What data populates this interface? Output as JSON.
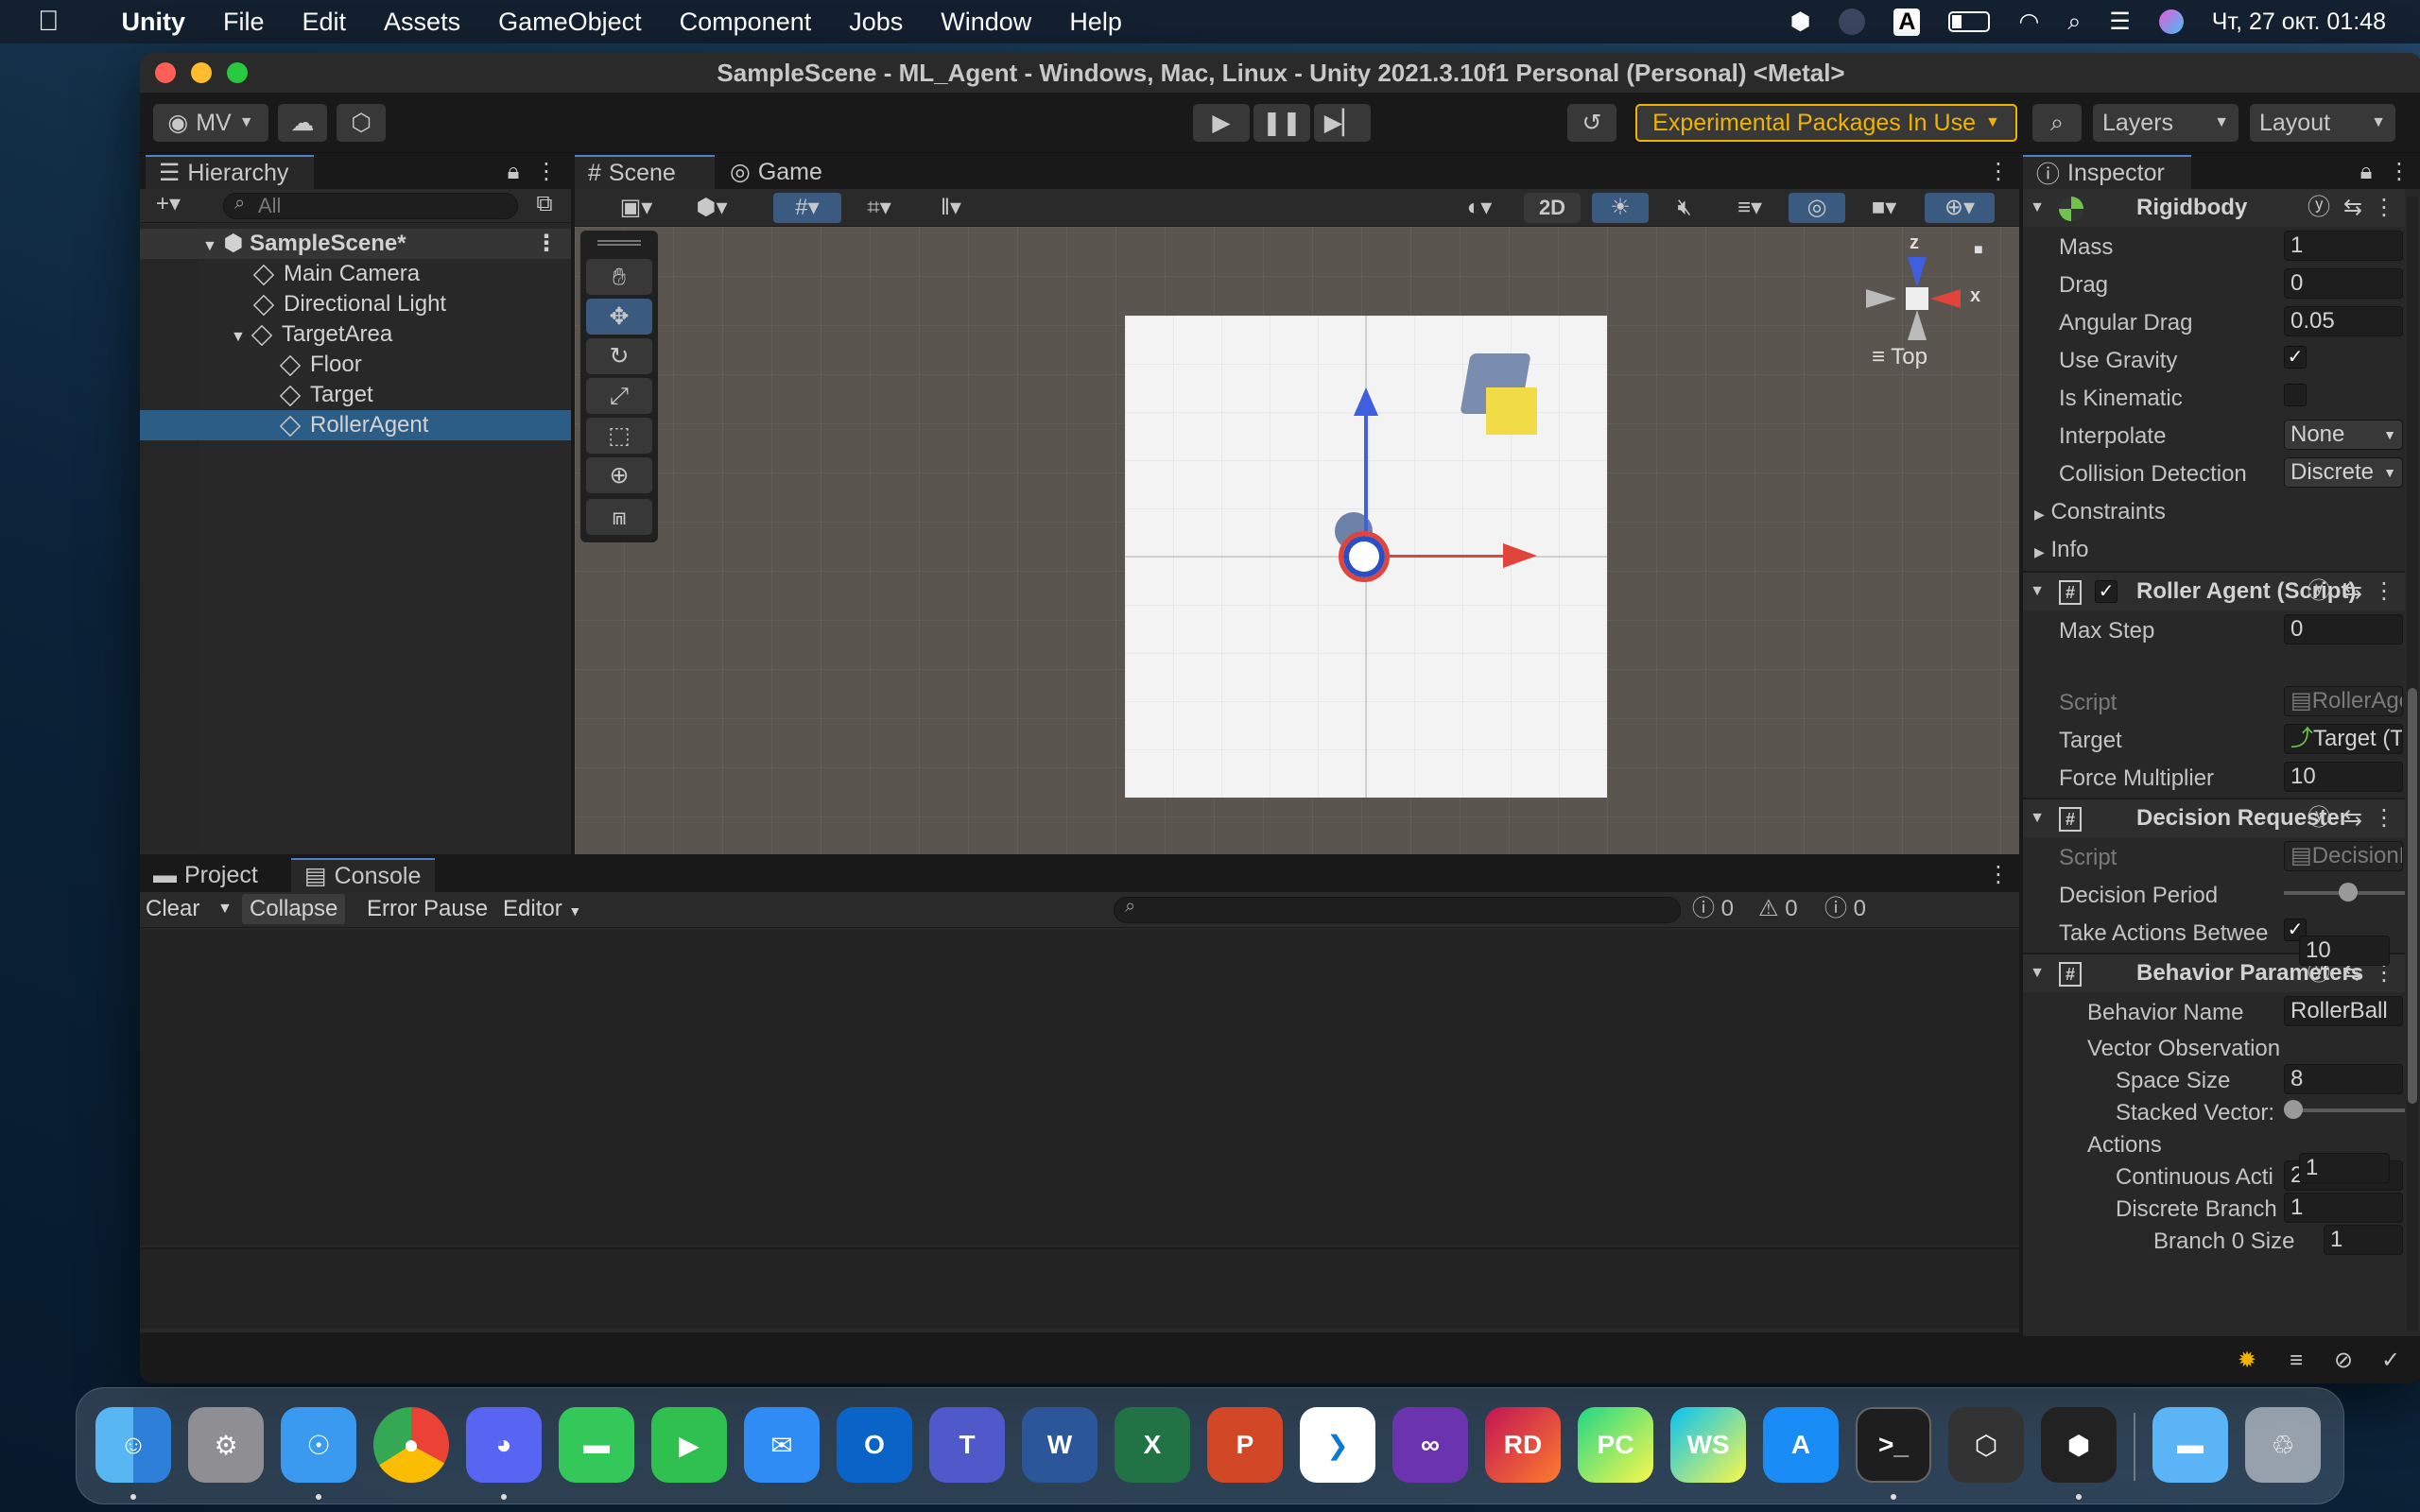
{
  "menubar": {
    "app": "Unity",
    "items": [
      "File",
      "Edit",
      "Assets",
      "GameObject",
      "Component",
      "Jobs",
      "Window",
      "Help"
    ],
    "clock": "Чт, 27 окт.  01:48",
    "input_source": "A"
  },
  "window": {
    "title": "SampleScene - ML_Agent - Windows, Mac, Linux - Unity 2021.3.10f1 Personal (Personal) <Metal>"
  },
  "toolbar": {
    "account": "MV",
    "experimental_warning": "Experimental Packages In Use",
    "layers": "Layers",
    "layout": "Layout"
  },
  "hierarchy": {
    "tab": "Hierarchy",
    "search_placeholder": "All",
    "scene": "SampleScene*",
    "items": [
      {
        "label": "Main Camera"
      },
      {
        "label": "Directional Light"
      },
      {
        "label": "TargetArea"
      },
      {
        "label": "Floor"
      },
      {
        "label": "Target"
      },
      {
        "label": "RollerAgent"
      }
    ]
  },
  "scene_view": {
    "tabs": [
      "Scene",
      "Game"
    ],
    "mode_2d": "2D",
    "gizmo_view": "Top",
    "axis_z": "z",
    "axis_x": "x"
  },
  "console": {
    "tabs": [
      "Project",
      "Console"
    ],
    "clear": "Clear",
    "collapse": "Collapse",
    "error_pause": "Error Pause",
    "editor": "Editor",
    "count_info": "0",
    "count_warn": "0",
    "count_error": "0"
  },
  "inspector": {
    "tab": "Inspector",
    "rigidbody": {
      "title": "Rigidbody",
      "mass_label": "Mass",
      "mass": "1",
      "drag_label": "Drag",
      "drag": "0",
      "angular_drag_label": "Angular Drag",
      "angular_drag": "0.05",
      "use_gravity_label": "Use Gravity",
      "use_gravity": true,
      "is_kinematic_label": "Is Kinematic",
      "is_kinematic": false,
      "interpolate_label": "Interpolate",
      "interpolate": "None",
      "collision_label": "Collision Detection",
      "collision": "Discrete",
      "constraints": "Constraints",
      "info": "Info"
    },
    "roller_agent": {
      "title": "Roller Agent (Script)",
      "max_step_label": "Max Step",
      "max_step": "0",
      "script_label": "Script",
      "script": "RollerAgent",
      "target_label": "Target",
      "target": "Target (Transfor",
      "force_label": "Force Multiplier",
      "force": "10"
    },
    "decision_requester": {
      "title": "Decision Requester",
      "script_label": "Script",
      "script": "DecisionReques",
      "period_label": "Decision Period",
      "period": "10",
      "period_fraction": 0.45,
      "take_actions_label": "Take Actions Betwee",
      "take_actions": true
    },
    "behavior_parameters": {
      "title": "Behavior Parameters",
      "name_label": "Behavior Name",
      "name": "RollerBall",
      "vector_obs": "Vector Observation",
      "space_size_label": "Space Size",
      "space_size": "8",
      "stacked_label": "Stacked Vector:",
      "stacked": "1",
      "stacked_fraction": 0.0,
      "actions": "Actions",
      "continuous_label": "Continuous Acti",
      "continuous": "2",
      "discrete_label": "Discrete Branch",
      "discrete": "1",
      "branch0_label": "Branch 0 Size",
      "branch0": "1"
    }
  },
  "dock": {
    "apps": [
      "finder-icon",
      "settings-icon",
      "safari-icon",
      "chrome-icon",
      "discord-icon",
      "messages-icon",
      "facetime-icon",
      "mail-icon",
      "outlook-icon",
      "teams-icon",
      "word-icon",
      "excel-icon",
      "powerpoint-icon",
      "vscode-icon",
      "visual-studio-icon",
      "rider-icon",
      "pycharm-icon",
      "webstorm-icon",
      "app-store-icon",
      "terminal-icon",
      "unity-hub-icon",
      "unity-icon",
      "downloads-folder-icon",
      "trash-icon"
    ],
    "labels": {
      "rider": "RD",
      "pycharm": "PC",
      "webstorm": "WS",
      "terminal": ">_",
      "outlook": "O",
      "teams": "T",
      "word": "W",
      "excel": "X",
      "powerpoint": "P"
    }
  },
  "colors": {
    "selection": "#2c5d87",
    "warning": "#f0b400",
    "accent": "#4d80c8"
  }
}
